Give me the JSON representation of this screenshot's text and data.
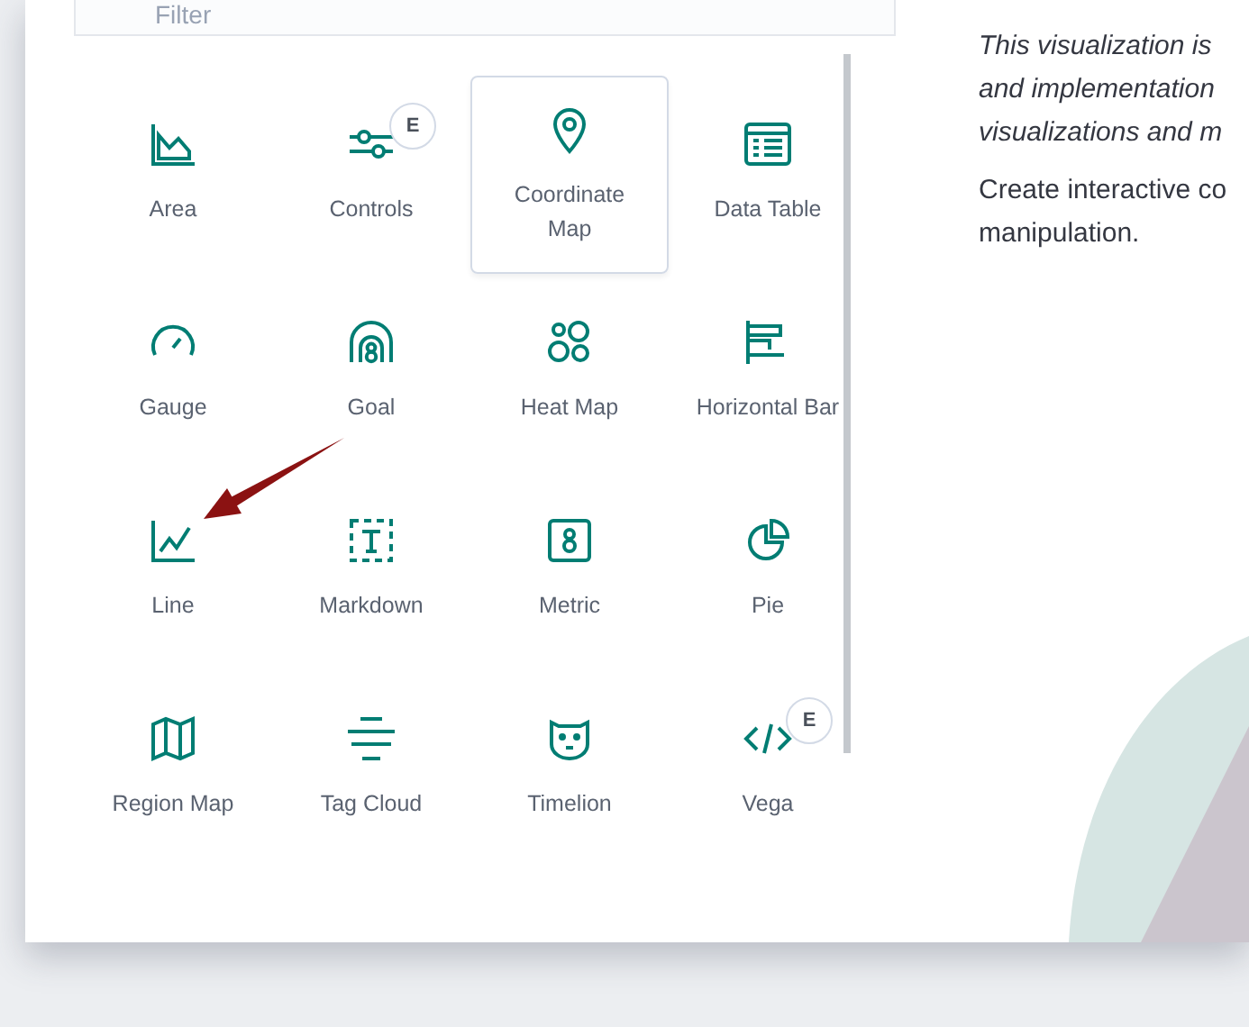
{
  "filter": {
    "placeholder": "Filter"
  },
  "items": [
    {
      "label": "Area",
      "selected": false
    },
    {
      "label": "Controls",
      "selected": false,
      "badge": "E"
    },
    {
      "label": "Coordinate Map",
      "selected": true
    },
    {
      "label": "Data Table",
      "selected": false
    },
    {
      "label": "Gauge",
      "selected": false
    },
    {
      "label": "Goal",
      "selected": false
    },
    {
      "label": "Heat Map",
      "selected": false
    },
    {
      "label": "Horizontal Bar",
      "selected": false
    },
    {
      "label": "Line",
      "selected": false
    },
    {
      "label": "Markdown",
      "selected": false
    },
    {
      "label": "Metric",
      "selected": false
    },
    {
      "label": "Pie",
      "selected": false
    },
    {
      "label": "Region Map",
      "selected": false
    },
    {
      "label": "Tag Cloud",
      "selected": false
    },
    {
      "label": "Timelion",
      "selected": false
    },
    {
      "label": "Vega",
      "selected": false,
      "badge": "E"
    }
  ],
  "description": {
    "experimental_lines": [
      "This visualization is",
      "and implementation",
      "visualizations and m"
    ],
    "body_lines": [
      "Create interactive co",
      "manipulation."
    ]
  }
}
